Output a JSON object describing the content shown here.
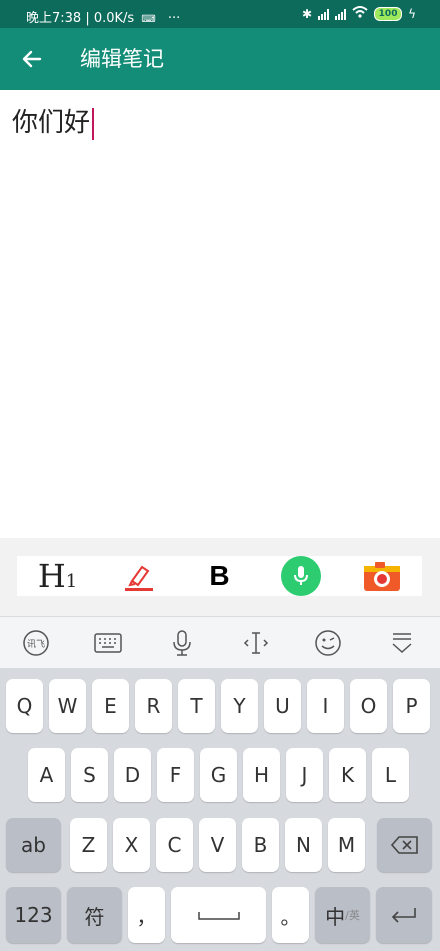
{
  "status_bar": {
    "time_text": "晚上7:38 | 0.0K/s",
    "overflow": "···",
    "battery": "100",
    "icons": [
      "keyboard-icon",
      "bluetooth-icon",
      "signal-icon",
      "wifi-icon",
      "battery-icon",
      "charging-icon"
    ]
  },
  "app_bar": {
    "title": "编辑笔记",
    "back_icon": "back-arrow-icon"
  },
  "editor": {
    "text": "你们好"
  },
  "format_bar": {
    "heading_label": "H",
    "heading_sub": "1",
    "bold_label": "B"
  },
  "ime_toolbar": {
    "icons": [
      "ime-logo-icon",
      "keyboard-icon",
      "mic-icon",
      "cursor-icon",
      "emoji-icon",
      "hide-keyboard-icon"
    ]
  },
  "keyboard": {
    "row1": [
      "Q",
      "W",
      "E",
      "R",
      "T",
      "Y",
      "U",
      "I",
      "O",
      "P"
    ],
    "row2": [
      "A",
      "S",
      "D",
      "F",
      "G",
      "H",
      "J",
      "K",
      "L"
    ],
    "row3_left": "ab",
    "row3": [
      "Z",
      "X",
      "C",
      "V",
      "B",
      "N",
      "M"
    ],
    "row4": {
      "num": "123",
      "symbol": "符",
      "comma": "，",
      "period": "。",
      "lang_main": "中",
      "lang_sub": "/英"
    }
  },
  "colors": {
    "status_bar": "#0d6b5b",
    "app_bar": "#138d77",
    "accent_cursor": "#c2185b",
    "mic_green": "#2ecc71",
    "camera_orange": "#f05a28"
  }
}
